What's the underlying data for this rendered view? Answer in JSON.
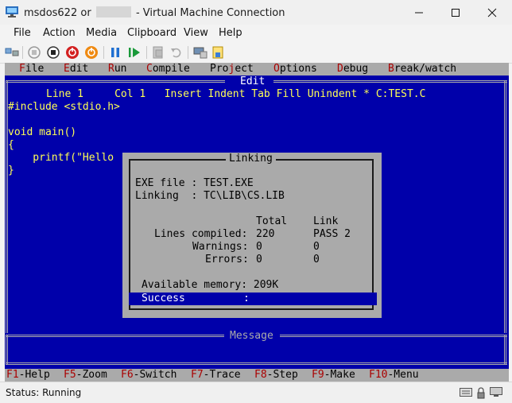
{
  "window": {
    "title_left": "msdos622 or",
    "title_right": "- Virtual Machine Connection"
  },
  "menubar": [
    "File",
    "Action",
    "Media",
    "Clipboard",
    "View",
    "Help"
  ],
  "toolbar": {
    "icons": [
      "ctrl-alt-del-icon",
      "start-icon",
      "turn-off-icon",
      "shut-down-icon",
      "save-icon",
      "pause-icon",
      "resume-icon",
      "checkpoint-icon",
      "revert-icon",
      "enhanced-session-icon",
      "share-icon"
    ]
  },
  "dos": {
    "menu": [
      {
        "hk": "F",
        "rest": "ile"
      },
      {
        "hk": "E",
        "rest": "dit"
      },
      {
        "hk": "R",
        "rest": "un"
      },
      {
        "hk": "C",
        "rest": "ompile"
      },
      {
        "pre": "Pro",
        "hk": "j",
        "rest": "ect"
      },
      {
        "hk": "O",
        "rest": "ptions"
      },
      {
        "hk": "D",
        "rest": "ebug"
      },
      {
        "hk": "B",
        "rest": "reak/watch"
      }
    ],
    "edit_title": "Edit",
    "status_line": "Line 1     Col 1   Insert Indent Tab Fill Unindent * C:TEST.C",
    "code": [
      "#include <stdio.h>",
      "",
      "void main()",
      "{",
      "    printf(\"Hello",
      "}"
    ],
    "message_title": "Message",
    "dialog": {
      "title": "Linking",
      "exe_label": "EXE file : TEST.EXE",
      "linking_label": "Linking  : TC\\LIB\\CS.LIB",
      "header_total": "Total",
      "header_link": "Link",
      "rows": [
        {
          "label": "Lines compiled:",
          "total": "220",
          "link": "PASS 2"
        },
        {
          "label": "Warnings:",
          "total": "0",
          "link": "0"
        },
        {
          "label": "Errors:",
          "total": "0",
          "link": "0"
        }
      ],
      "memory": "Available memory: 209K",
      "success_label": "Success",
      "success_colon": ":"
    },
    "fkeys": [
      {
        "k": "F1",
        "t": "-Help"
      },
      {
        "k": "F5",
        "t": "-Zoom"
      },
      {
        "k": "F6",
        "t": "-Switch"
      },
      {
        "k": "F7",
        "t": "-Trace"
      },
      {
        "k": "F8",
        "t": "-Step"
      },
      {
        "k": "F9",
        "t": "-Make"
      },
      {
        "k": "F10",
        "t": "-Menu"
      }
    ]
  },
  "status": {
    "text": "Status: Running",
    "icons": [
      "keyboard-icon",
      "lock-icon",
      "screen-icon"
    ]
  }
}
